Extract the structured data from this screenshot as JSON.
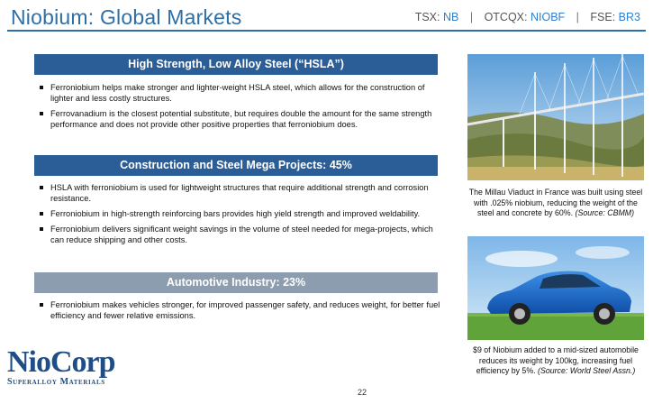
{
  "header": {
    "title": "Niobium: Global Markets",
    "tickers": [
      {
        "exchange": "TSX:",
        "symbol": "NB"
      },
      {
        "exchange": "OTCQX:",
        "symbol": "NIOBF"
      },
      {
        "exchange": "FSE:",
        "symbol": "BR3"
      }
    ],
    "separator": "|"
  },
  "sections": [
    {
      "heading": "High Strength, Low Alloy Steel (“HSLA”)",
      "bullets": [
        "Ferroniobium helps make stronger and lighter-weight HSLA steel, which allows for the construction of lighter and less costly structures.",
        "Ferrovanadium is the closest potential substitute, but requires double the amount for the same strength performance and does not provide other positive properties that ferroniobium does."
      ]
    },
    {
      "heading": "Construction and Steel Mega Projects: 45%",
      "bullets": [
        "HSLA with ferroniobium is used for lightweight structures that require additional strength and corrosion resistance.",
        "Ferroniobium in high-strength reinforcing bars provides high yield strength and improved weldability.",
        "Ferroniobium delivers significant weight savings in the volume of steel needed for mega-projects, which can reduce shipping and other costs."
      ]
    },
    {
      "heading": "Automotive Industry: 23%",
      "bullets": [
        "Ferroniobium makes vehicles stronger, for improved passenger safety, and reduces weight, for better fuel efficiency and fewer relative emissions."
      ]
    }
  ],
  "images": {
    "bridge_caption": "The Millau Viaduct in France was built using steel with .025% niobium, reducing the weight of the steel and concrete by 60%.",
    "bridge_source": "(Source: CBMM)",
    "car_caption": "$9 of Niobium added to a mid-sized automobile reduces its weight by 100kg, increasing fuel efficiency by 5%.",
    "car_source": "(Source: World Steel Assn.)"
  },
  "logo": {
    "main": "NioCorp",
    "sub": "Superalloy Materials"
  },
  "page_number": "22",
  "colors": {
    "title_blue": "#2e6fa7",
    "band_dark": "#2b5d97",
    "band_grey": "#8b9dae",
    "ticker_symbol": "#2e7fd0"
  }
}
